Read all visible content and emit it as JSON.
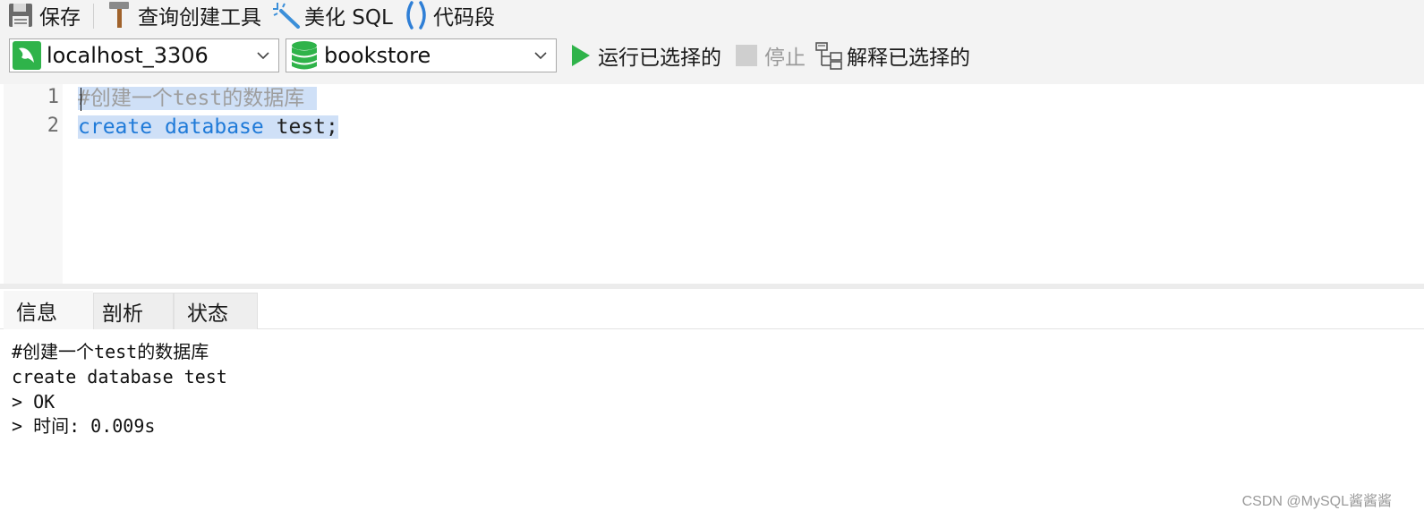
{
  "toolbar": {
    "save_label": "保存",
    "query_builder_label": "查询创建工具",
    "beautify_label": "美化 SQL",
    "snippet_label": "代码段"
  },
  "connection": {
    "selected": "localhost_3306",
    "icon": "mysql-dolphin-icon",
    "icon_color": "#2fb34a"
  },
  "database": {
    "selected": "bookstore",
    "icon": "database-stack-icon",
    "icon_color": "#2fb34a"
  },
  "actions": {
    "run_selected_label": "运行已选择的",
    "stop_label": "停止",
    "explain_selected_label": "解释已选择的"
  },
  "editor": {
    "lines": [
      {
        "number": "1",
        "text": "#创建一个test的数据库"
      },
      {
        "number": "2",
        "keyword1": "create",
        "keyword2": "database",
        "rest": "test;"
      }
    ],
    "selection_color": "#cfe0f7",
    "keyword_color": "#1f7ad8",
    "comment_color": "#9e9e9e"
  },
  "tabs": [
    {
      "label": "信息",
      "active": true
    },
    {
      "label": "剖析",
      "active": false
    },
    {
      "label": "状态",
      "active": false
    }
  ],
  "output": {
    "lines": [
      "#创建一个test的数据库",
      "create database test",
      "> OK",
      "> 时间: 0.009s"
    ]
  },
  "watermark": "CSDN @MySQL酱酱酱"
}
